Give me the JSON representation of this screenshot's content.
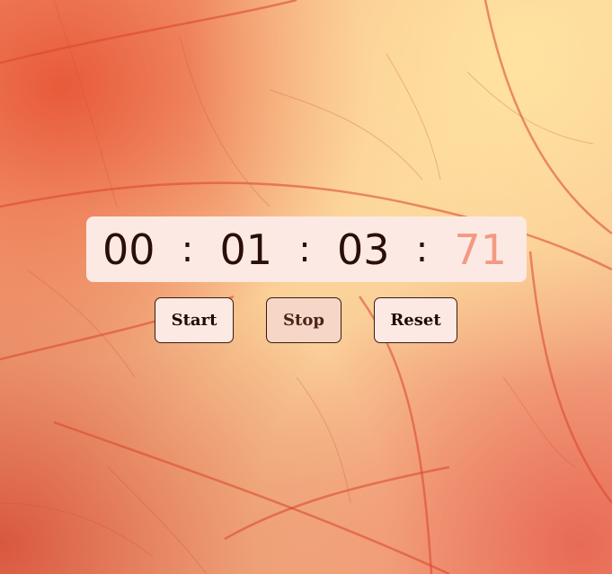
{
  "timer": {
    "hours": "00",
    "minutes": "01",
    "seconds": "03",
    "centiseconds": "71",
    "separator": ":"
  },
  "controls": {
    "start_label": "Start",
    "stop_label": "Stop",
    "reset_label": "Reset"
  },
  "colors": {
    "display_background": "#fde9e4",
    "digits": "#2a0e08",
    "centiseconds": "#f39a82"
  }
}
